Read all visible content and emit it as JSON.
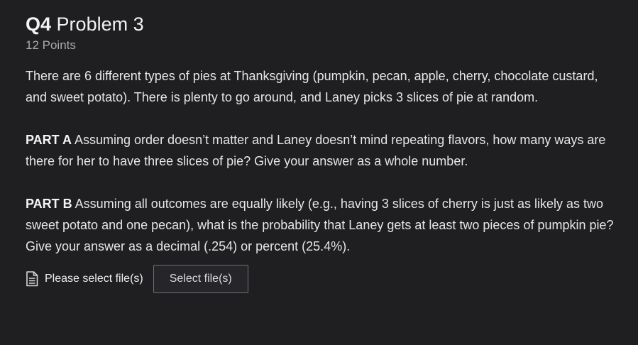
{
  "question": {
    "number": "Q4",
    "title": "Problem 3",
    "points": "12 Points",
    "intro": "There are 6 different types of pies at Thanksgiving (pumpkin, pecan, apple, cherry, chocolate custard, and sweet potato). There is plenty to go around, and Laney picks 3 slices of pie at random.",
    "part_a": {
      "label": "PART A",
      "text": " Assuming order doesn’t matter and Laney doesn’t mind repeating flavors, how many ways are there for her to have three slices of pie? Give your answer as a whole number."
    },
    "part_b": {
      "label": "PART B",
      "text": " Assuming all outcomes are equally likely (e.g., having 3 slices of cherry is just as likely as two sweet potato and one pecan), what is the probability that Laney gets at least two pieces of pumpkin pie? Give your answer as a decimal (.254) or percent (25.4%)."
    }
  },
  "upload": {
    "icon": "file-text-icon",
    "label": "Please select file(s)",
    "button_label": "Select file(s)"
  }
}
